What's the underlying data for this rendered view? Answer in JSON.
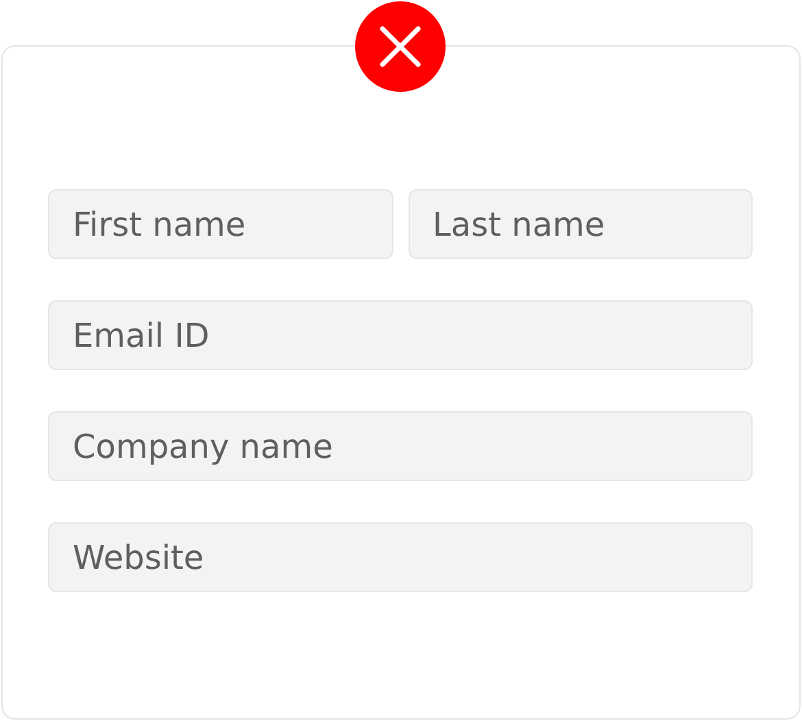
{
  "form_rows": [
    [
      {
        "placeholder": "First name"
      },
      {
        "placeholder": "Last name"
      }
    ],
    [
      {
        "placeholder": "Email ID"
      }
    ],
    [
      {
        "placeholder": "Company name"
      }
    ],
    [
      {
        "placeholder": "Website"
      }
    ]
  ]
}
